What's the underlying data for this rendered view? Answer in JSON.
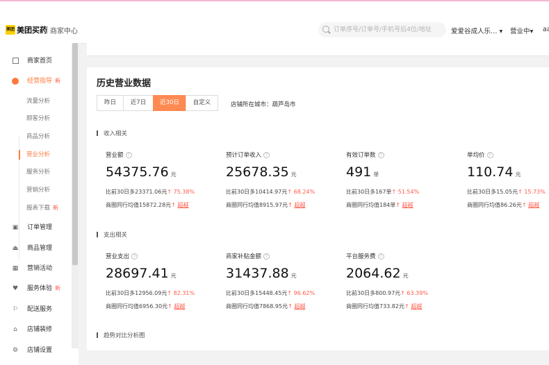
{
  "header": {
    "logo": "美团买药",
    "divider": "|",
    "subtitle": "商家中心",
    "search_placeholder": "订单序号/订单号/手机号后4位/地址",
    "store": "爱爱谷成人乐…",
    "status": "营业中",
    "user": "aa"
  },
  "sidebar": {
    "items": [
      {
        "label": "商家首页",
        "icon": "grid-icon",
        "tag": ""
      },
      {
        "label": "经营指导",
        "icon": "pie-icon",
        "tag": "新"
      },
      {
        "label": "订单管理",
        "icon": "order-icon",
        "tag": ""
      },
      {
        "label": "商品管理",
        "icon": "goods-icon",
        "tag": ""
      },
      {
        "label": "营销活动",
        "icon": "marketing-icon",
        "tag": ""
      },
      {
        "label": "服务体验",
        "icon": "heart-icon",
        "tag": "新"
      },
      {
        "label": "配送服务",
        "icon": "delivery-icon",
        "tag": ""
      },
      {
        "label": "店铺装修",
        "icon": "store-icon",
        "tag": ""
      },
      {
        "label": "店铺设置",
        "icon": "settings-icon",
        "tag": ""
      }
    ],
    "subitems": [
      {
        "label": "流量分析",
        "tag": ""
      },
      {
        "label": "顾客分析",
        "tag": ""
      },
      {
        "label": "商品分析",
        "tag": ""
      },
      {
        "label": "营业分析",
        "tag": ""
      },
      {
        "label": "服务分析",
        "tag": ""
      },
      {
        "label": "营销分析",
        "tag": ""
      },
      {
        "label": "报表下载",
        "tag": "新"
      }
    ]
  },
  "panel": {
    "title": "历史营业数据",
    "tabs": [
      "昨日",
      "近7日",
      "近30日",
      "自定义"
    ],
    "active_tab": "近30日",
    "city_label": "店铺所在城市：",
    "city": "葫芦岛市",
    "income_section": "收入相关",
    "expense_section": "支出相关",
    "trend_section": "趋势对比分析图",
    "income_cards": [
      {
        "label": "营业额",
        "value": "54375.76",
        "unit": "元",
        "compare": "比前30日多23371.06元",
        "pct": "↑ 75.38%",
        "avg": "商圈同行均值15872.28元",
        "avg_trend": "↑",
        "beyond": "超越"
      },
      {
        "label": "预计订单收入",
        "value": "25678.35",
        "unit": "元",
        "compare": "比前30日多10414.97元",
        "pct": "↑ 68.24%",
        "avg": "商圈同行均值8915.97元",
        "avg_trend": "↑",
        "beyond": "超越"
      },
      {
        "label": "有效订单数",
        "value": "491",
        "unit": "单",
        "compare": "比前30日多167单",
        "pct": "↑ 51.54%",
        "avg": "商圈同行均值184单",
        "avg_trend": "↑",
        "beyond": "超越"
      },
      {
        "label": "单均价",
        "value": "110.74",
        "unit": "元",
        "compare": "比前30日多15.05元",
        "pct": "↑ 15.73%",
        "avg": "商圈同行均值86.26元",
        "avg_trend": "↑",
        "beyond": "超越"
      }
    ],
    "expense_cards": [
      {
        "label": "营业支出",
        "value": "28697.41",
        "unit": "元",
        "compare": "比前30日多12956.09元",
        "pct": "↑ 82.31%",
        "avg": "商圈同行均值6956.30元",
        "avg_trend": "↑",
        "beyond": "超越"
      },
      {
        "label": "商家补贴金额",
        "value": "31437.88",
        "unit": "元",
        "compare": "比前30日多15448.45元",
        "pct": "↑ 96.62%",
        "avg": "商圈同行均值7868.95元",
        "avg_trend": "↑",
        "beyond": "超越"
      },
      {
        "label": "平台服务费",
        "value": "2064.62",
        "unit": "元",
        "compare": "比前30日多800.97元",
        "pct": "↑ 63.39%",
        "avg": "商圈同行均值733.82元",
        "avg_trend": "↑",
        "beyond": "超越"
      }
    ]
  }
}
